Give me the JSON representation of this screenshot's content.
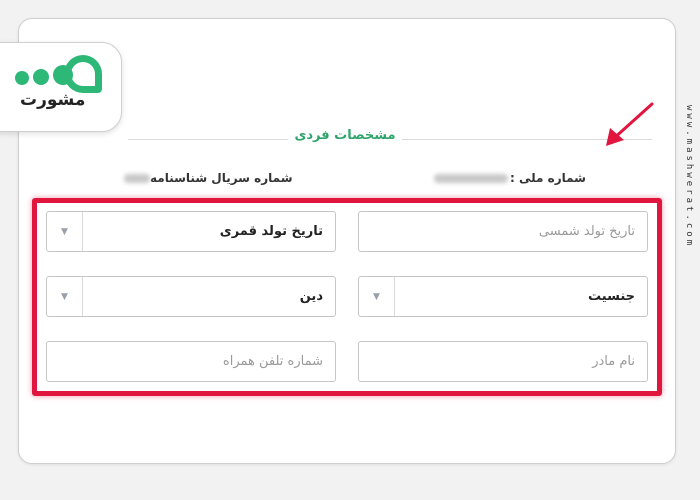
{
  "brand": {
    "name": "مشورت",
    "watermark": "www.mashwerat.com",
    "accent": "#2db877"
  },
  "section": {
    "title": "مشخصات فردی"
  },
  "info": {
    "national_id_label": "شماره ملی :",
    "serial_label": "شماره سریال شناسنامه"
  },
  "form": {
    "birth_solar": {
      "placeholder": "تاریخ تولد شمسی"
    },
    "birth_lunar": {
      "value": "تاریخ تولد قمری",
      "icon": "chevron-down-icon"
    },
    "gender": {
      "value": "جنسیت",
      "icon": "chevron-down-icon"
    },
    "religion": {
      "value": "دین",
      "icon": "chevron-down-icon"
    },
    "mother_name": {
      "placeholder": "نام مادر"
    },
    "mobile": {
      "placeholder": "شماره تلفن همراه"
    }
  },
  "annotation": {
    "highlight_color": "#e0163f",
    "arrow_color": "#e0163f"
  }
}
